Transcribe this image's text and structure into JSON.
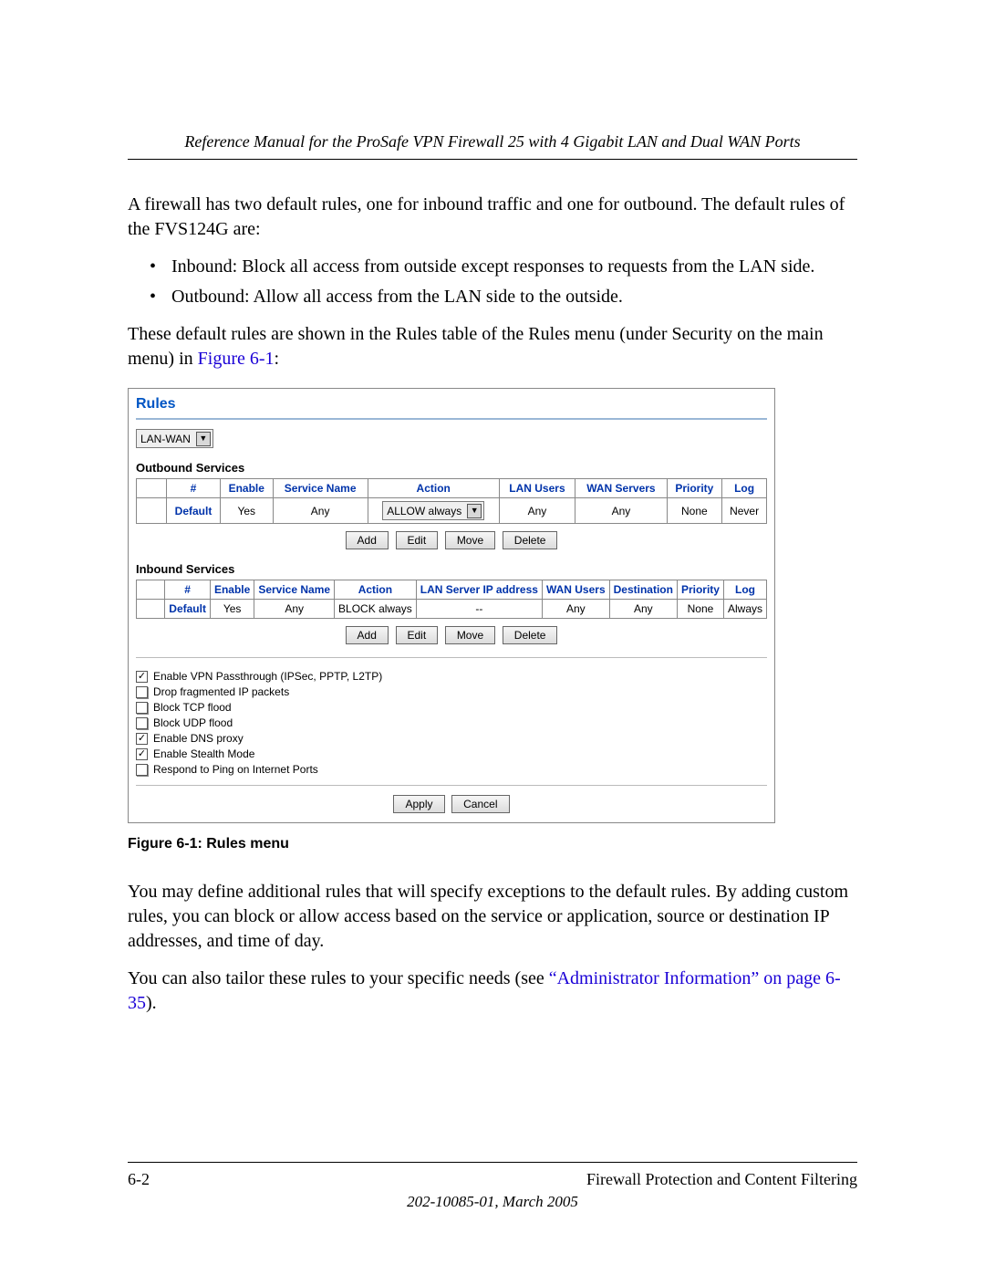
{
  "header": {
    "running_title": "Reference Manual for the ProSafe VPN Firewall 25 with 4 Gigabit LAN and Dual WAN Ports"
  },
  "body": {
    "p1": "A firewall has two default rules, one for inbound traffic and one for outbound. The default rules of the FVS124G are:",
    "bullets": [
      "Inbound: Block all access from outside except responses to requests from the LAN side.",
      "Outbound: Allow all access from the LAN side to the outside."
    ],
    "p2_pre": "These default rules are shown in the Rules table of the Rules menu (under Security on the main menu) in ",
    "p2_link": "Figure 6-1",
    "p2_post": ":",
    "caption": "Figure 6-1:  Rules menu",
    "p3": "You may define additional rules that will specify exceptions to the default rules. By adding custom rules, you can block or allow access based on the service or application, source or destination IP addresses, and time of day.",
    "p4_pre": "You can also tailor these rules to your specific needs (see ",
    "p4_link": "“Administrator Information” on page 6-35",
    "p4_post": ")."
  },
  "ui": {
    "title": "Rules",
    "direction_select": "LAN-WAN",
    "outbound": {
      "label": "Outbound Services",
      "headers": [
        "",
        "#",
        "Enable",
        "Service Name",
        "Action",
        "LAN Users",
        "WAN Servers",
        "Priority",
        "Log"
      ],
      "row": {
        "num": "Default",
        "enable": "Yes",
        "service": "Any",
        "action_select": "ALLOW always",
        "lan_users": "Any",
        "wan_servers": "Any",
        "priority": "None",
        "log": "Never"
      }
    },
    "inbound": {
      "label": "Inbound Services",
      "headers": [
        "",
        "#",
        "Enable",
        "Service Name",
        "Action",
        "LAN Server IP address",
        "WAN Users",
        "Destination",
        "Priority",
        "Log"
      ],
      "row": {
        "num": "Default",
        "enable": "Yes",
        "service": "Any",
        "action": "BLOCK always",
        "lan_server_ip": "--",
        "wan_users": "Any",
        "destination": "Any",
        "priority": "None",
        "log": "Always"
      }
    },
    "buttons": {
      "add": "Add",
      "edit": "Edit",
      "move": "Move",
      "delete": "Delete",
      "apply": "Apply",
      "cancel": "Cancel"
    },
    "checks": [
      {
        "checked": true,
        "label": "Enable VPN Passthrough (IPSec, PPTP, L2TP)"
      },
      {
        "checked": false,
        "label": "Drop fragmented IP packets"
      },
      {
        "checked": false,
        "label": "Block TCP flood"
      },
      {
        "checked": false,
        "label": "Block UDP flood"
      },
      {
        "checked": true,
        "label": "Enable DNS proxy"
      },
      {
        "checked": true,
        "label": "Enable Stealth Mode"
      },
      {
        "checked": false,
        "label": "Respond to Ping on Internet Ports"
      }
    ]
  },
  "footer": {
    "page_num": "6-2",
    "section": "Firewall Protection and Content Filtering",
    "docnum": "202-10085-01, March 2005"
  }
}
